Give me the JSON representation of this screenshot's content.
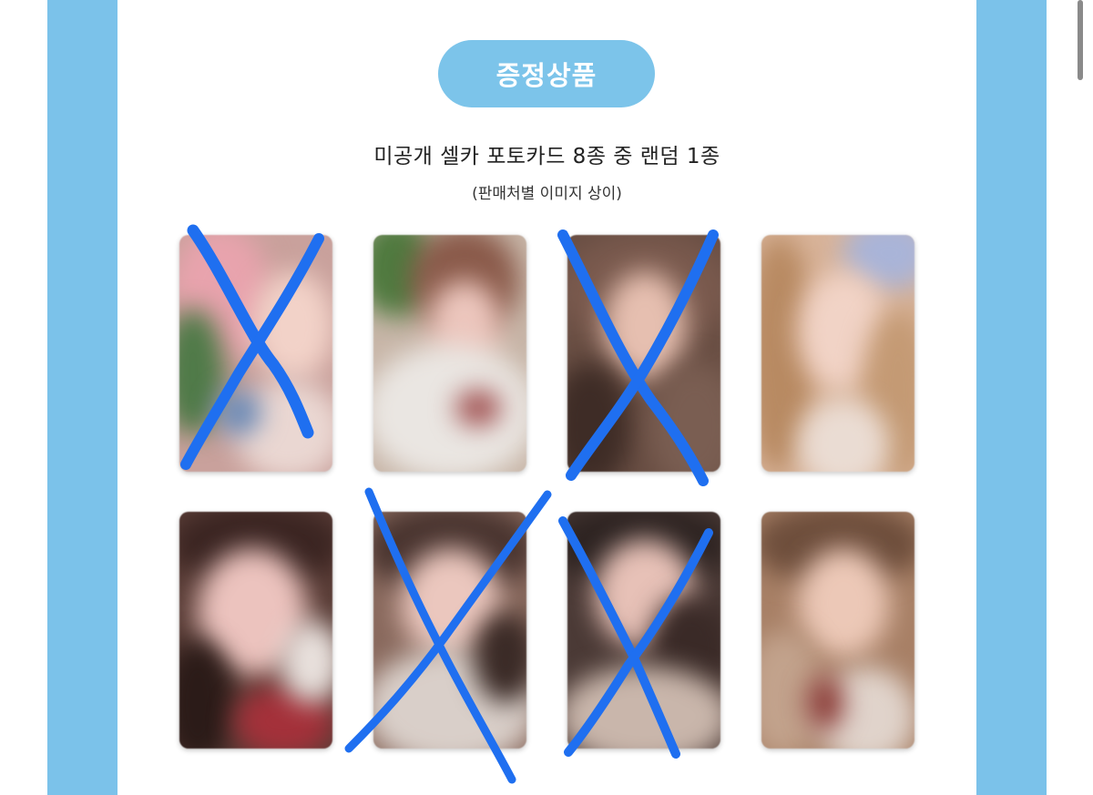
{
  "badge": {
    "label": "증정상품"
  },
  "headline": "미공개 셀카 포토카드 8종 중 랜덤 1종",
  "subline": "(판매처별 이미지 상이)",
  "colors": {
    "side_bars": "#7bc2ea",
    "badge": "#7cc4ea",
    "cross_marks": "#1f6ff0"
  },
  "photocards": [
    {
      "id": 1,
      "crossed_out": true
    },
    {
      "id": 2,
      "crossed_out": false
    },
    {
      "id": 3,
      "crossed_out": true
    },
    {
      "id": 4,
      "crossed_out": false
    },
    {
      "id": 5,
      "crossed_out": false
    },
    {
      "id": 6,
      "crossed_out": true
    },
    {
      "id": 7,
      "crossed_out": true
    },
    {
      "id": 8,
      "crossed_out": false
    }
  ]
}
